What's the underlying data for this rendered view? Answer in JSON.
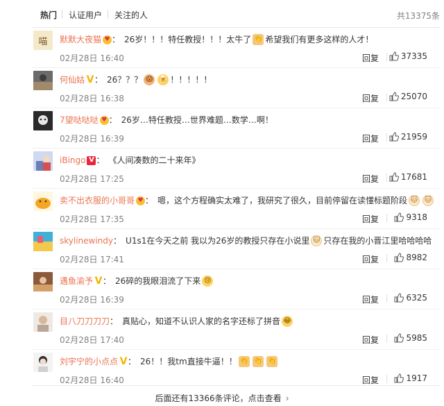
{
  "tabs": {
    "hot": "热门",
    "verified": "认证用户",
    "following": "关注的人",
    "total_count": "共13375条"
  },
  "comments": [
    {
      "username": "默默大夜猫",
      "badge": "heart",
      "segments": [
        "26岁！！！特任教授！！！太牛了",
        "希望我们有更多这样的人才！"
      ],
      "date": "02月28日 16:40",
      "reply": "回复",
      "likes": "37335"
    },
    {
      "username": "何仙姑",
      "badge": "v-gold",
      "segments": [
        "26？？？",
        "！！！！！"
      ],
      "date": "02月28日 16:38",
      "reply": "回复",
      "likes": "25070"
    },
    {
      "username": "7望哒哒哒",
      "badge": "heart",
      "segments": [
        "26岁…特任教授…世界难题…数学…啊！"
      ],
      "date": "02月28日 16:39",
      "reply": "回复",
      "likes": "21959"
    },
    {
      "username": "iBingo",
      "badge": "v-red",
      "segments": [
        "《人间凑数的二十来年》"
      ],
      "date": "02月28日 17:25",
      "reply": "回复",
      "likes": "17681"
    },
    {
      "username": "卖不出衣服的小哥哥",
      "badge": "heart",
      "segments": [
        "嗯，这个方程确实太难了，我研究了很久，目前停留在读懂标题阶段"
      ],
      "date": "02月28日 17:35",
      "reply": "回复",
      "likes": "9318"
    },
    {
      "username": "skylinewindy",
      "badge": "",
      "segments": [
        "U1s1在今天之前 我以为26岁的教授只存在小说里",
        "只存在我的小晋江里哈哈哈哈"
      ],
      "date": "02月28日 17:41",
      "reply": "回复",
      "likes": "8982"
    },
    {
      "username": "遇鱼渝予",
      "badge": "v-gold",
      "segments": [
        "26碎的我眼泪流了下来"
      ],
      "date": "02月28日 16:39",
      "reply": "回复",
      "likes": "6325"
    },
    {
      "username": "目八刀刀刀刀",
      "badge": "",
      "segments": [
        "真贴心，知道不认识人家的名字还标了拼音"
      ],
      "date": "02月28日 17:40",
      "reply": "回复",
      "likes": "5985"
    },
    {
      "username": "刘宇宁的小点点",
      "badge": "v-gold",
      "segments": [
        "26！！我tm直接牛逼！！"
      ],
      "date": "02月28日 16:40",
      "reply": "回复",
      "likes": "1917"
    }
  ],
  "footer": {
    "more_text": "后面还有13366条评论，点击查看"
  }
}
